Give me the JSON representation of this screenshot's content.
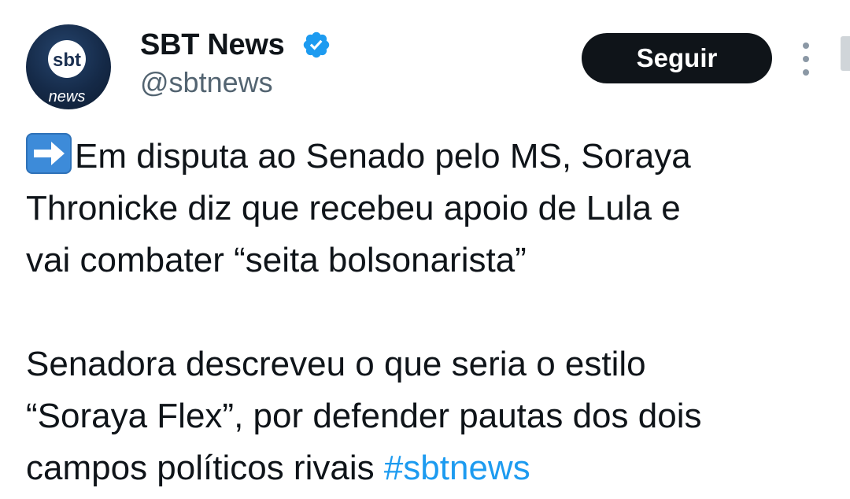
{
  "author": {
    "name": "SBT News",
    "handle": "@sbtnews",
    "avatar_logo_top": "sbt",
    "avatar_logo_bottom": "news",
    "verified": true
  },
  "actions": {
    "follow_label": "Seguir",
    "more_icon": "more-vertical-icon"
  },
  "tweet": {
    "emoji": "arrow-right-icon",
    "paragraph1": "Em disputa ao Senado pelo MS, Soraya\nThronicke diz que recebeu apoio de Lula e\nvai combater “seita bolsonarista”",
    "paragraph2": "Senadora descreveu o que seria o estilo\n“Soraya Flex”, por defender pautas dos dois\ncampos políticos rivais ",
    "hashtag": "#sbtnews"
  },
  "colors": {
    "text": "#0f1419",
    "secondary": "#536471",
    "link": "#1d9bf0",
    "verified": "#1d9bf0",
    "button": "#0f1419",
    "emoji_bg": "#3d8bd9"
  }
}
